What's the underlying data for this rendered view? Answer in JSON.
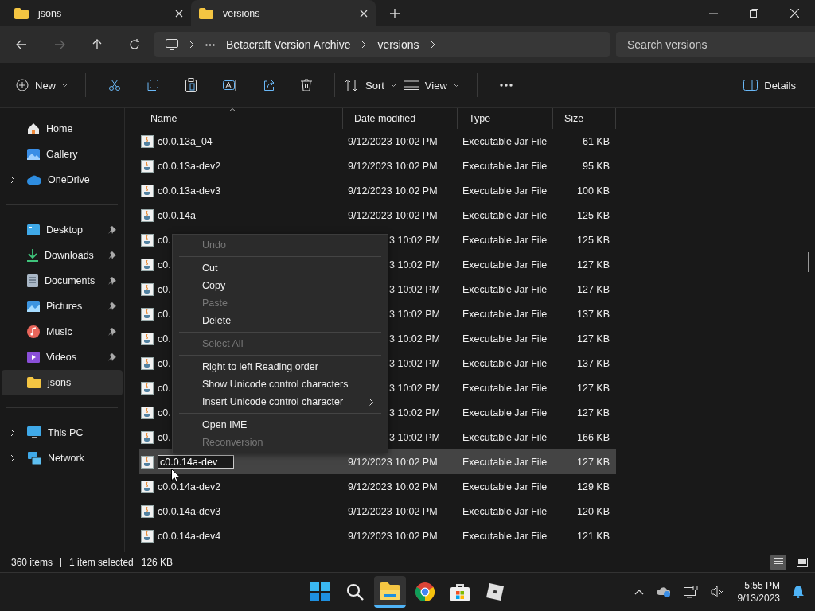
{
  "tabs": [
    {
      "label": "jsons",
      "selected": false
    },
    {
      "label": "versions",
      "selected": true
    }
  ],
  "breadcrumb": [
    "Betacraft Version Archive",
    "versions"
  ],
  "search": {
    "placeholder": "Search versions"
  },
  "toolbar": {
    "new": "New",
    "sort": "Sort",
    "view": "View",
    "details": "Details"
  },
  "sidebar": [
    {
      "label": "Home",
      "pinned": false,
      "expandable": false,
      "selected": false
    },
    {
      "label": "Gallery",
      "pinned": false,
      "expandable": false,
      "selected": false
    },
    {
      "label": "OneDrive",
      "pinned": false,
      "expandable": true,
      "selected": false
    },
    {
      "label": "Desktop",
      "pinned": true,
      "expandable": false,
      "selected": false
    },
    {
      "label": "Downloads",
      "pinned": true,
      "expandable": false,
      "selected": false
    },
    {
      "label": "Documents",
      "pinned": true,
      "expandable": false,
      "selected": false
    },
    {
      "label": "Pictures",
      "pinned": true,
      "expandable": false,
      "selected": false
    },
    {
      "label": "Music",
      "pinned": true,
      "expandable": false,
      "selected": false
    },
    {
      "label": "Videos",
      "pinned": true,
      "expandable": false,
      "selected": false
    },
    {
      "label": "jsons",
      "pinned": false,
      "expandable": false,
      "selected": true
    },
    {
      "label": "This PC",
      "pinned": false,
      "expandable": true,
      "selected": false
    },
    {
      "label": "Network",
      "pinned": false,
      "expandable": true,
      "selected": false
    }
  ],
  "table": {
    "columns": [
      "Name",
      "Date modified",
      "Type",
      "Size"
    ],
    "rows": [
      {
        "name": "c0.0.13a_04",
        "date": "9/12/2023 10:02 PM",
        "type": "Executable Jar File",
        "size": "61 KB",
        "covered": false,
        "selected": false,
        "editing": false
      },
      {
        "name": "c0.0.13a-dev2",
        "date": "9/12/2023 10:02 PM",
        "type": "Executable Jar File",
        "size": "95 KB",
        "covered": false,
        "selected": false,
        "editing": false
      },
      {
        "name": "c0.0.13a-dev3",
        "date": "9/12/2023 10:02 PM",
        "type": "Executable Jar File",
        "size": "100 KB",
        "covered": false,
        "selected": false,
        "editing": false
      },
      {
        "name": "c0.0.14a",
        "date": "9/12/2023 10:02 PM",
        "type": "Executable Jar File",
        "size": "125 KB",
        "covered": false,
        "selected": false,
        "editing": false
      },
      {
        "name": "c0.",
        "date": "3 10:02 PM",
        "type": "Executable Jar File",
        "size": "125 KB",
        "covered": true,
        "selected": false,
        "editing": false
      },
      {
        "name": "c0.",
        "date": "3 10:02 PM",
        "type": "Executable Jar File",
        "size": "127 KB",
        "covered": true,
        "selected": false,
        "editing": false
      },
      {
        "name": "c0.",
        "date": "3 10:02 PM",
        "type": "Executable Jar File",
        "size": "127 KB",
        "covered": true,
        "selected": false,
        "editing": false
      },
      {
        "name": "c0.",
        "date": "3 10:02 PM",
        "type": "Executable Jar File",
        "size": "137 KB",
        "covered": true,
        "selected": false,
        "editing": false
      },
      {
        "name": "c0.",
        "date": "3 10:02 PM",
        "type": "Executable Jar File",
        "size": "127 KB",
        "covered": true,
        "selected": false,
        "editing": false
      },
      {
        "name": "c0.",
        "date": "3 10:02 PM",
        "type": "Executable Jar File",
        "size": "137 KB",
        "covered": true,
        "selected": false,
        "editing": false
      },
      {
        "name": "c0.",
        "date": "3 10:02 PM",
        "type": "Executable Jar File",
        "size": "127 KB",
        "covered": true,
        "selected": false,
        "editing": false
      },
      {
        "name": "c0.",
        "date": "3 10:02 PM",
        "type": "Executable Jar File",
        "size": "127 KB",
        "covered": true,
        "selected": false,
        "editing": false
      },
      {
        "name": "c0.",
        "date": "3 10:02 PM",
        "type": "Executable Jar File",
        "size": "166 KB",
        "covered": true,
        "selected": false,
        "editing": false
      },
      {
        "name": "c0.0.14a-dev",
        "date": "9/12/2023 10:02 PM",
        "type": "Executable Jar File",
        "size": "127 KB",
        "covered": false,
        "selected": true,
        "editing": true
      },
      {
        "name": "c0.0.14a-dev2",
        "date": "9/12/2023 10:02 PM",
        "type": "Executable Jar File",
        "size": "129 KB",
        "covered": false,
        "selected": false,
        "editing": false
      },
      {
        "name": "c0.0.14a-dev3",
        "date": "9/12/2023 10:02 PM",
        "type": "Executable Jar File",
        "size": "120 KB",
        "covered": false,
        "selected": false,
        "editing": false
      },
      {
        "name": "c0.0.14a-dev4",
        "date": "9/12/2023 10:02 PM",
        "type": "Executable Jar File",
        "size": "121 KB",
        "covered": false,
        "selected": false,
        "editing": false
      }
    ]
  },
  "context_menu": [
    {
      "kind": "item",
      "label": "Undo",
      "disabled": true,
      "submenu": false
    },
    {
      "kind": "separator"
    },
    {
      "kind": "item",
      "label": "Cut",
      "disabled": false,
      "submenu": false
    },
    {
      "kind": "item",
      "label": "Copy",
      "disabled": false,
      "submenu": false
    },
    {
      "kind": "item",
      "label": "Paste",
      "disabled": true,
      "submenu": false
    },
    {
      "kind": "item",
      "label": "Delete",
      "disabled": false,
      "submenu": false
    },
    {
      "kind": "separator"
    },
    {
      "kind": "item",
      "label": "Select All",
      "disabled": true,
      "submenu": false
    },
    {
      "kind": "separator"
    },
    {
      "kind": "item",
      "label": "Right to left Reading order",
      "disabled": false,
      "submenu": false
    },
    {
      "kind": "item",
      "label": "Show Unicode control characters",
      "disabled": false,
      "submenu": false
    },
    {
      "kind": "item",
      "label": "Insert Unicode control character",
      "disabled": false,
      "submenu": true
    },
    {
      "kind": "separator"
    },
    {
      "kind": "item",
      "label": "Open IME",
      "disabled": false,
      "submenu": false
    },
    {
      "kind": "item",
      "label": "Reconversion",
      "disabled": true,
      "submenu": false
    }
  ],
  "status_bar": {
    "count": "360 items",
    "selection": "1 item selected",
    "size": "126 KB",
    "view_buttons": [
      {
        "selected": true
      },
      {
        "selected": false
      }
    ]
  },
  "taskbar": {
    "apps": [
      {
        "selected": false
      },
      {
        "selected": false
      },
      {
        "selected": true
      },
      {
        "selected": false
      },
      {
        "selected": false
      },
      {
        "selected": false
      }
    ],
    "time": "5:55 PM",
    "date": "9/13/2023"
  }
}
